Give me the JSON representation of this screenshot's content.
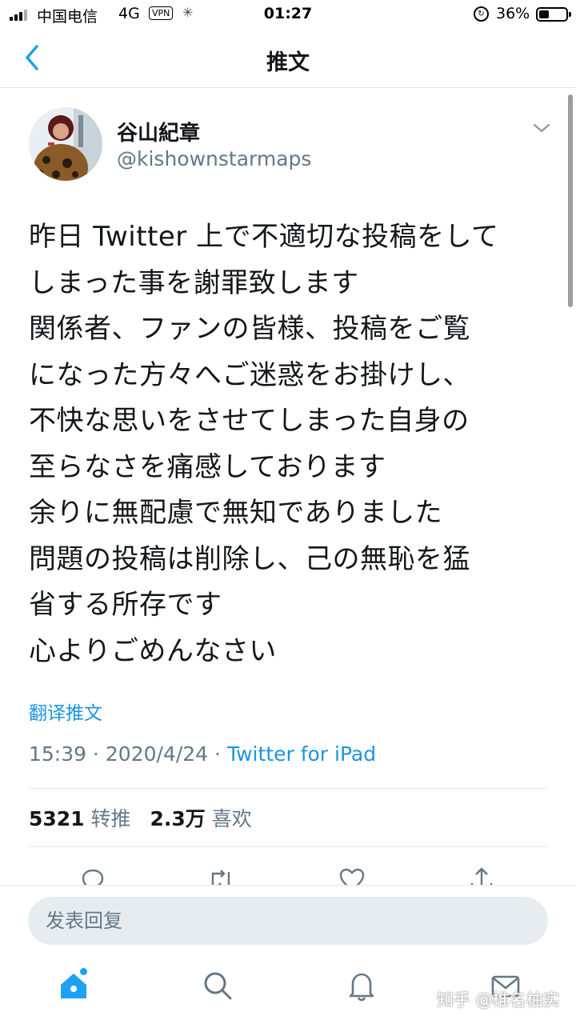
{
  "status_bar": {
    "carrier": "中国电信",
    "network": "4G",
    "vpn": "VPN",
    "time": "01:27",
    "battery": "36%"
  },
  "nav": {
    "title": "推文"
  },
  "tweet": {
    "display_name": "谷山紀章",
    "handle": "@kishownstarmaps",
    "lines": [
      "昨日 Twitter 上で不適切な投稿をして",
      "しまった事を謝罪致します",
      "関係者、ファンの皆様、投稿をご覧",
      "になった方々へご迷惑をお掛けし、",
      "不快な思いをさせてしまった自身の",
      "至らなさを痛感しております",
      "余りに無配慮で無知でありました",
      "問題の投稿は削除し、己の無恥を猛",
      "省する所存です",
      "心よりごめんなさい"
    ],
    "translate_label": "翻译推文",
    "time": "15:39",
    "date": "2020/4/24",
    "source": "Twitter for iPad",
    "retweet_count": "5321",
    "retweet_label": "转推",
    "like_count": "2.3万",
    "like_label": "喜欢"
  },
  "reply": {
    "placeholder": "发表回复"
  },
  "watermark": "知乎 @椎名柚实",
  "colors": {
    "accent": "#1da1f2",
    "link": "#1b95e0",
    "secondary_text": "#657786",
    "divider": "#e1e8ed"
  }
}
